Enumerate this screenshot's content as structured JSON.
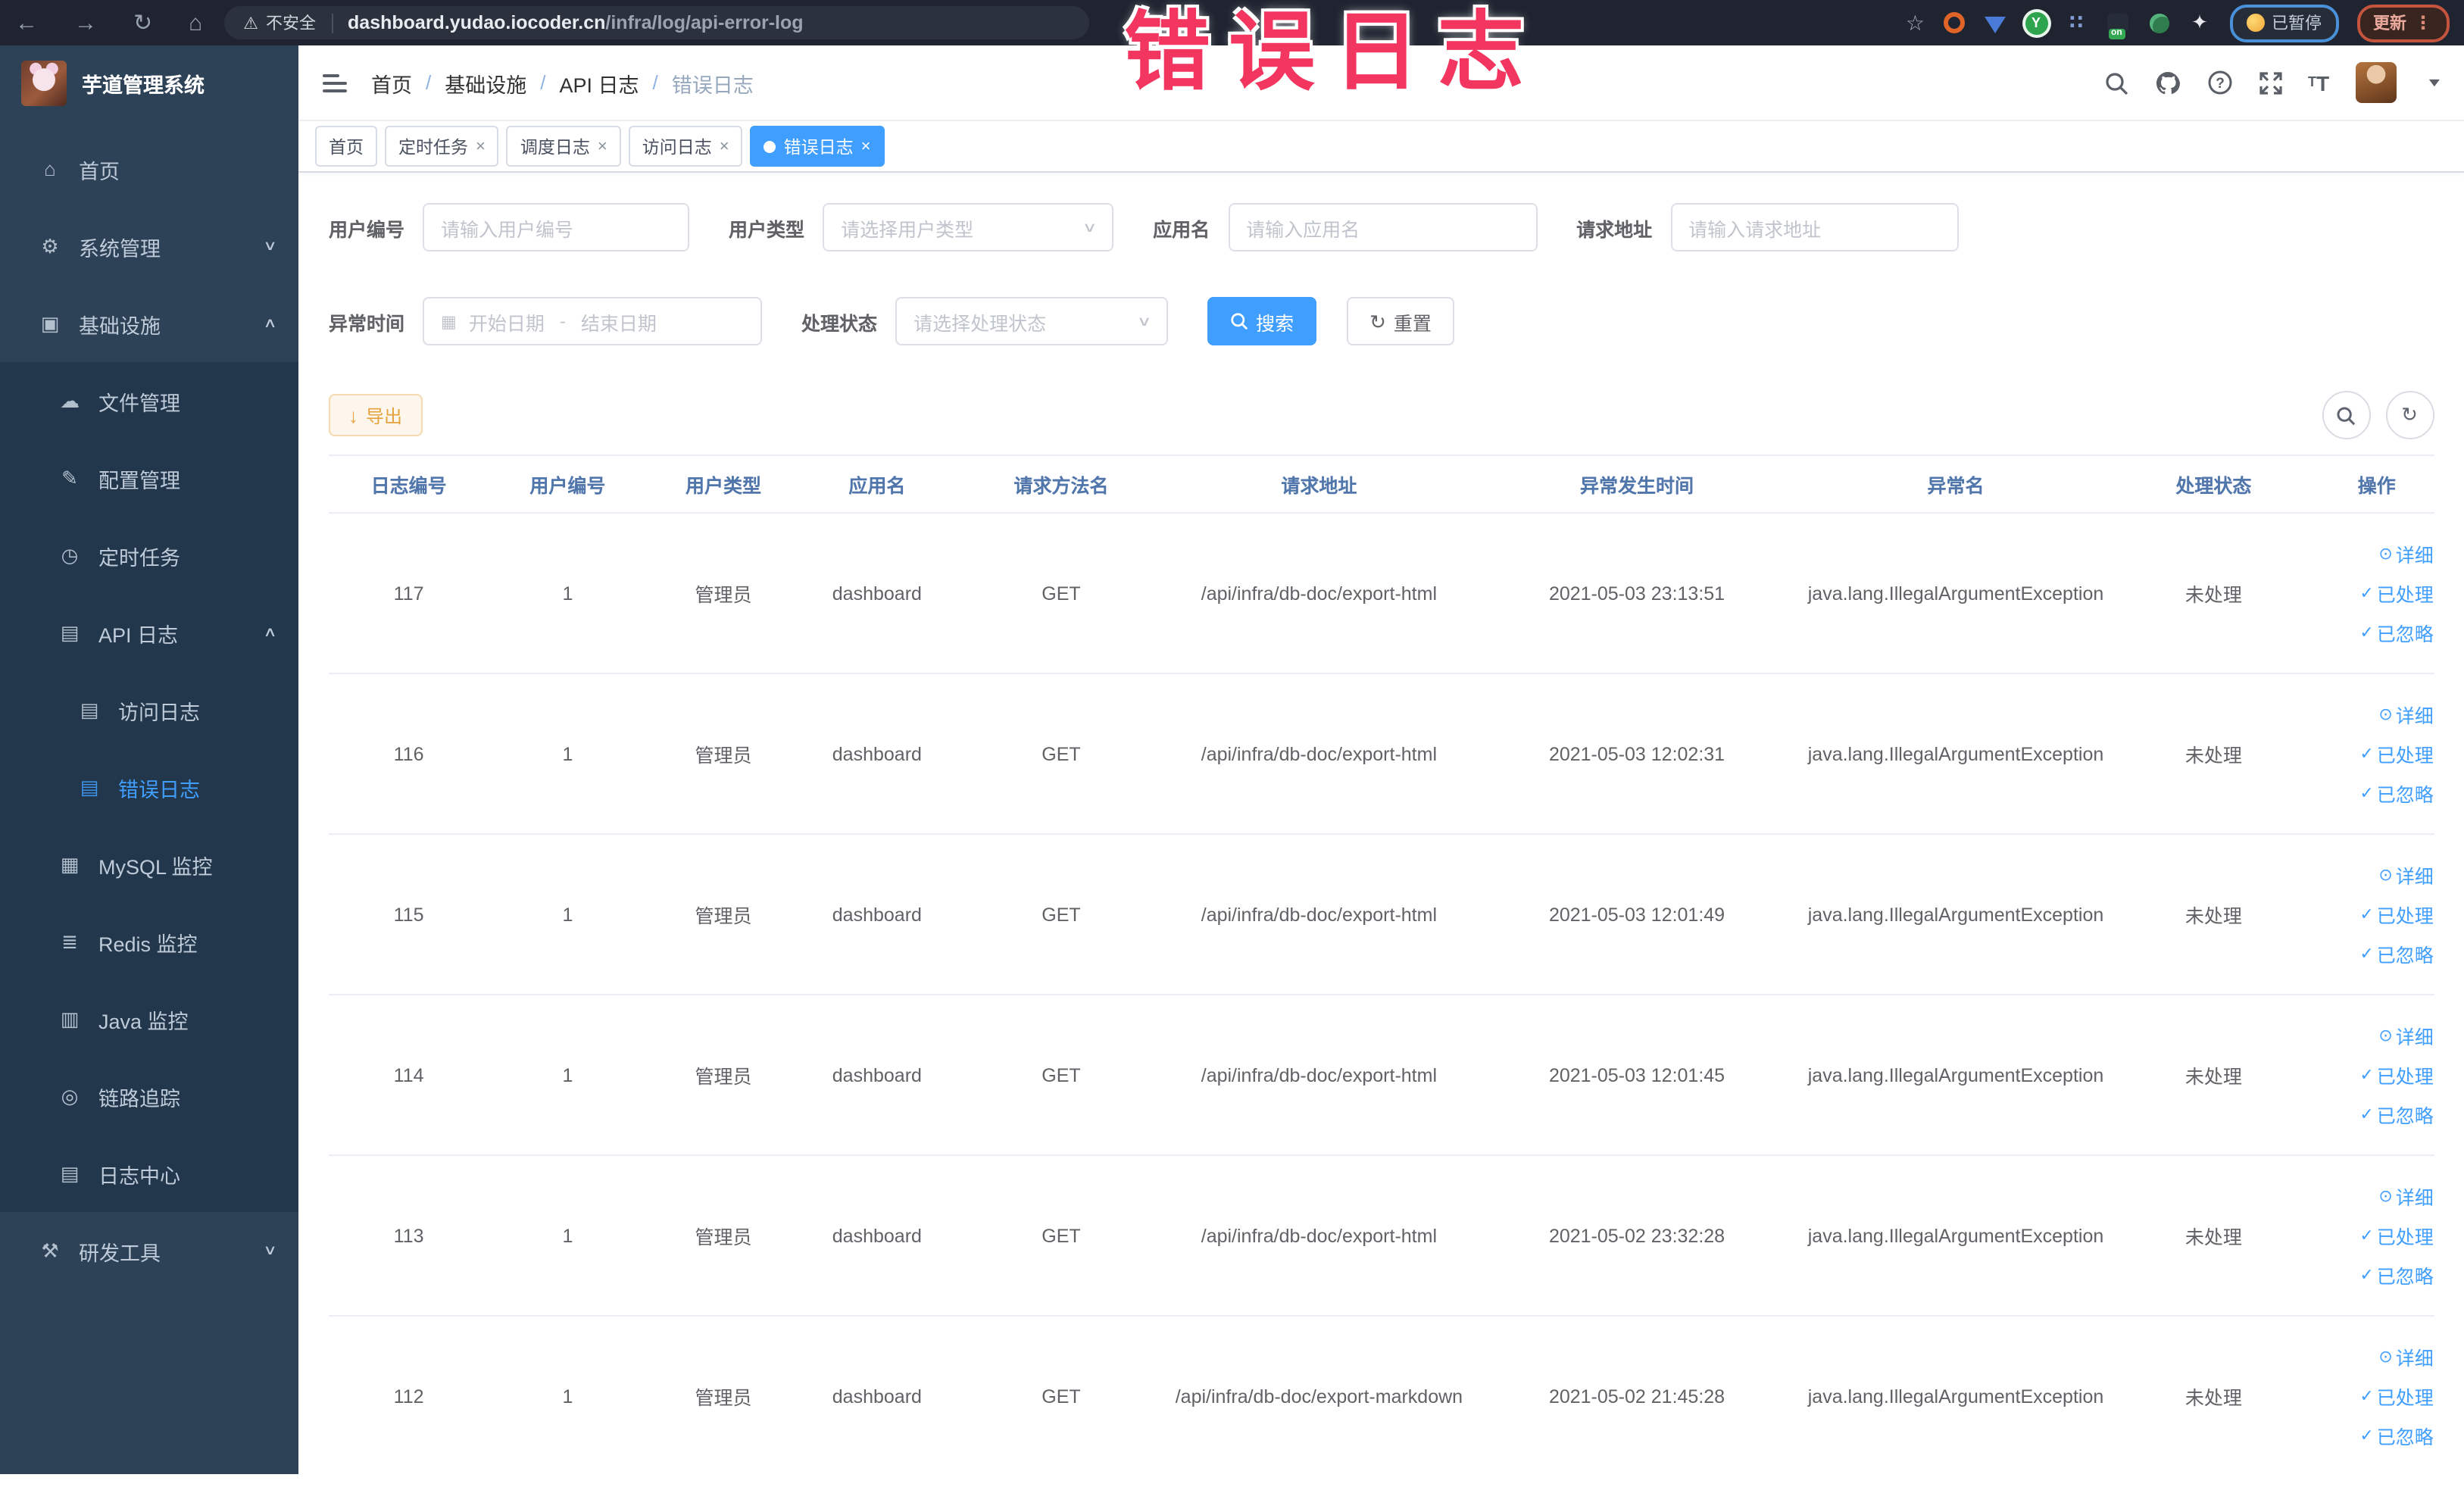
{
  "annotation": {
    "text": "错误日志",
    "color": "#f2365f"
  },
  "browser": {
    "security_label": "不安全",
    "url_host": "dashboard.yudao.iocoder.cn",
    "url_path": "/infra/log/api-error-log",
    "extensions": [
      "orange-ring-extension",
      "blue-shield-extension",
      "green-y-extension",
      "grid-extension",
      "switch-on-extension",
      "leaf-extension",
      "pin-extension"
    ],
    "paused_badge": "已暂停",
    "update_button": "更新"
  },
  "sidebar": {
    "title": "芋道管理系统",
    "menu": [
      {
        "label": "首页",
        "icon": "home-icon",
        "level": 0,
        "sub": false
      },
      {
        "label": "系统管理",
        "icon": "gear-icon",
        "level": 0,
        "sub": false,
        "arrow": "down"
      },
      {
        "label": "基础设施",
        "icon": "infrastructure-icon",
        "level": 0,
        "sub": false,
        "arrow": "up"
      },
      {
        "label": "文件管理",
        "icon": "file-manage-icon",
        "level": 1,
        "sub": true
      },
      {
        "label": "配置管理",
        "icon": "config-edit-icon",
        "level": 1,
        "sub": true
      },
      {
        "label": "定时任务",
        "icon": "timer-icon",
        "level": 1,
        "sub": true
      },
      {
        "label": "API 日志",
        "icon": "api-log-icon",
        "level": 1,
        "sub": true,
        "arrow": "up"
      },
      {
        "label": "访问日志",
        "icon": "access-log-icon",
        "level": 2,
        "sub": true
      },
      {
        "label": "错误日志",
        "icon": "error-log-icon",
        "level": 2,
        "sub": true,
        "active": true
      },
      {
        "label": "MySQL 监控",
        "icon": "mysql-monitor-icon",
        "level": 1,
        "sub": true
      },
      {
        "label": "Redis 监控",
        "icon": "redis-monitor-icon",
        "level": 1,
        "sub": true
      },
      {
        "label": "Java 监控",
        "icon": "java-monitor-icon",
        "level": 1,
        "sub": true
      },
      {
        "label": "链路追踪",
        "icon": "trace-icon",
        "level": 1,
        "sub": true
      },
      {
        "label": "日志中心",
        "icon": "log-center-icon",
        "level": 1,
        "sub": true
      },
      {
        "label": "研发工具",
        "icon": "dev-tools-icon",
        "level": 0,
        "sub": false,
        "arrow": "down"
      }
    ]
  },
  "header": {
    "breadcrumb": [
      "首页",
      "基础设施",
      "API 日志",
      "错误日志"
    ]
  },
  "tabs": [
    {
      "label": "首页",
      "closable": false,
      "active": false
    },
    {
      "label": "定时任务",
      "closable": true,
      "active": false
    },
    {
      "label": "调度日志",
      "closable": true,
      "active": false
    },
    {
      "label": "访问日志",
      "closable": true,
      "active": false
    },
    {
      "label": "错误日志",
      "closable": true,
      "active": true
    }
  ],
  "filters": {
    "user_id": {
      "label": "用户编号",
      "placeholder": "请输入用户编号"
    },
    "user_type": {
      "label": "用户类型",
      "placeholder": "请选择用户类型"
    },
    "app_name": {
      "label": "应用名",
      "placeholder": "请输入应用名"
    },
    "request_url": {
      "label": "请求地址",
      "placeholder": "请输入请求地址"
    },
    "exception_time": {
      "label": "异常时间",
      "start_placeholder": "开始日期",
      "separator": "-",
      "end_placeholder": "结束日期"
    },
    "process_status": {
      "label": "处理状态",
      "placeholder": "请选择处理状态"
    },
    "search_button": "搜索",
    "reset_button": "重置"
  },
  "toolbar": {
    "export_button": "导出"
  },
  "table": {
    "columns": [
      "日志编号",
      "用户编号",
      "用户类型",
      "应用名",
      "请求方法名",
      "请求地址",
      "异常发生时间",
      "异常名",
      "处理状态",
      "操作"
    ],
    "actions": [
      "详细",
      "已处理",
      "已忽略"
    ],
    "rows": [
      {
        "log_id": "117",
        "user_id": "1",
        "user_type": "管理员",
        "app_name": "dashboard",
        "method": "GET",
        "url": "/api/infra/db-doc/export-html",
        "time": "2021-05-03 23:13:51",
        "exception": "java.lang.IllegalArgumentException",
        "status": "未处理"
      },
      {
        "log_id": "116",
        "user_id": "1",
        "user_type": "管理员",
        "app_name": "dashboard",
        "method": "GET",
        "url": "/api/infra/db-doc/export-html",
        "time": "2021-05-03 12:02:31",
        "exception": "java.lang.IllegalArgumentException",
        "status": "未处理"
      },
      {
        "log_id": "115",
        "user_id": "1",
        "user_type": "管理员",
        "app_name": "dashboard",
        "method": "GET",
        "url": "/api/infra/db-doc/export-html",
        "time": "2021-05-03 12:01:49",
        "exception": "java.lang.IllegalArgumentException",
        "status": "未处理"
      },
      {
        "log_id": "114",
        "user_id": "1",
        "user_type": "管理员",
        "app_name": "dashboard",
        "method": "GET",
        "url": "/api/infra/db-doc/export-html",
        "time": "2021-05-03 12:01:45",
        "exception": "java.lang.IllegalArgumentException",
        "status": "未处理"
      },
      {
        "log_id": "113",
        "user_id": "1",
        "user_type": "管理员",
        "app_name": "dashboard",
        "method": "GET",
        "url": "/api/infra/db-doc/export-html",
        "time": "2021-05-02 23:32:28",
        "exception": "java.lang.IllegalArgumentException",
        "status": "未处理"
      },
      {
        "log_id": "112",
        "user_id": "1",
        "user_type": "管理员",
        "app_name": "dashboard",
        "method": "GET",
        "url": "/api/infra/db-doc/export-markdown",
        "time": "2021-05-02 21:45:28",
        "exception": "java.lang.IllegalArgumentException",
        "status": "未处理"
      }
    ]
  },
  "colors": {
    "accent": "#409eff",
    "warning": "#e6a23c",
    "annotation": "#f2365f",
    "sidebar_bg": "#2e4257",
    "submenu_bg": "#22374b"
  }
}
